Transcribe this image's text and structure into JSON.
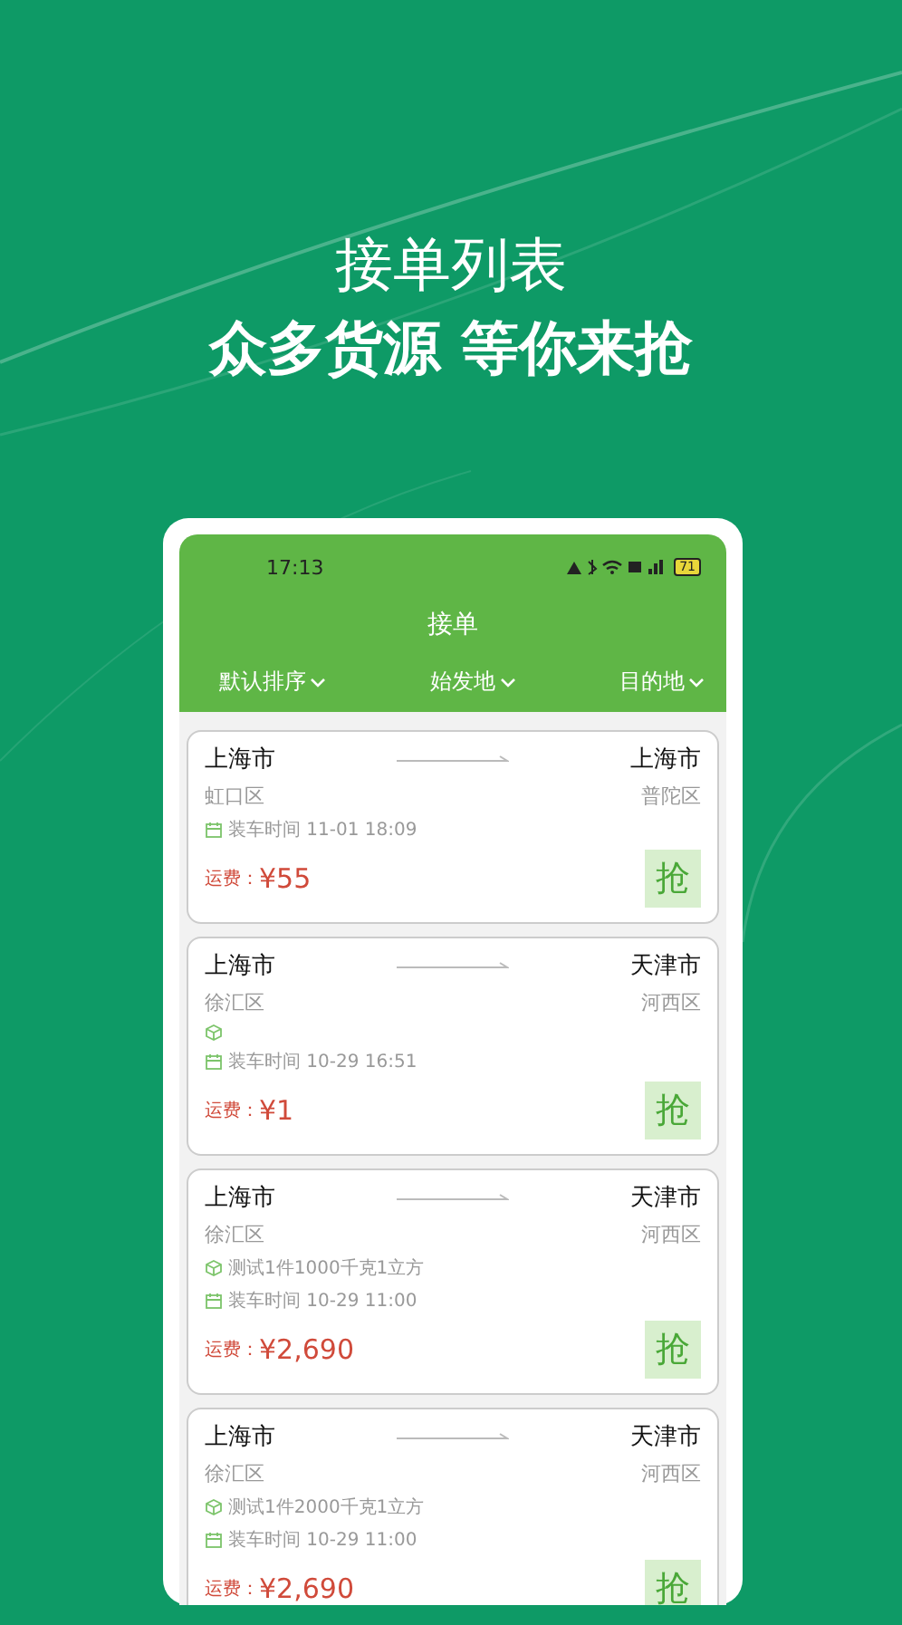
{
  "headline": "接单列表",
  "tagline": "众多货源 等你来抢",
  "status_bar": {
    "time": "17:13",
    "battery": "71"
  },
  "title": "接单",
  "filters": [
    {
      "label": "默认排序"
    },
    {
      "label": "始发地"
    },
    {
      "label": "目的地"
    }
  ],
  "orders": [
    {
      "from_city": "上海市",
      "from_district": "虹口区",
      "to_city": "上海市",
      "to_district": "普陀区",
      "cargo_shown": false,
      "load_time": "装车时间 11-01 18:09",
      "fee_label": "运费：",
      "price": "¥55",
      "grab": "抢"
    },
    {
      "from_city": "上海市",
      "from_district": "徐汇区",
      "to_city": "天津市",
      "to_district": "河西区",
      "cargo_shown": true,
      "load_time": "装车时间 10-29 16:51",
      "fee_label": "运费：",
      "price": "¥1",
      "grab": "抢"
    },
    {
      "from_city": "上海市",
      "from_district": "徐汇区",
      "to_city": "天津市",
      "to_district": "河西区",
      "cargo_shown": true,
      "cargo": "测试1件1000千克1立方",
      "load_time": "装车时间 10-29 11:00",
      "fee_label": "运费：",
      "price": "¥2,690",
      "grab": "抢"
    },
    {
      "from_city": "上海市",
      "from_district": "徐汇区",
      "to_city": "天津市",
      "to_district": "河西区",
      "cargo_shown": true,
      "cargo": "测试1件2000千克1立方",
      "load_time": "装车时间 10-29 11:00",
      "fee_label": "运费：",
      "price": "¥2,690",
      "grab": "抢"
    }
  ]
}
